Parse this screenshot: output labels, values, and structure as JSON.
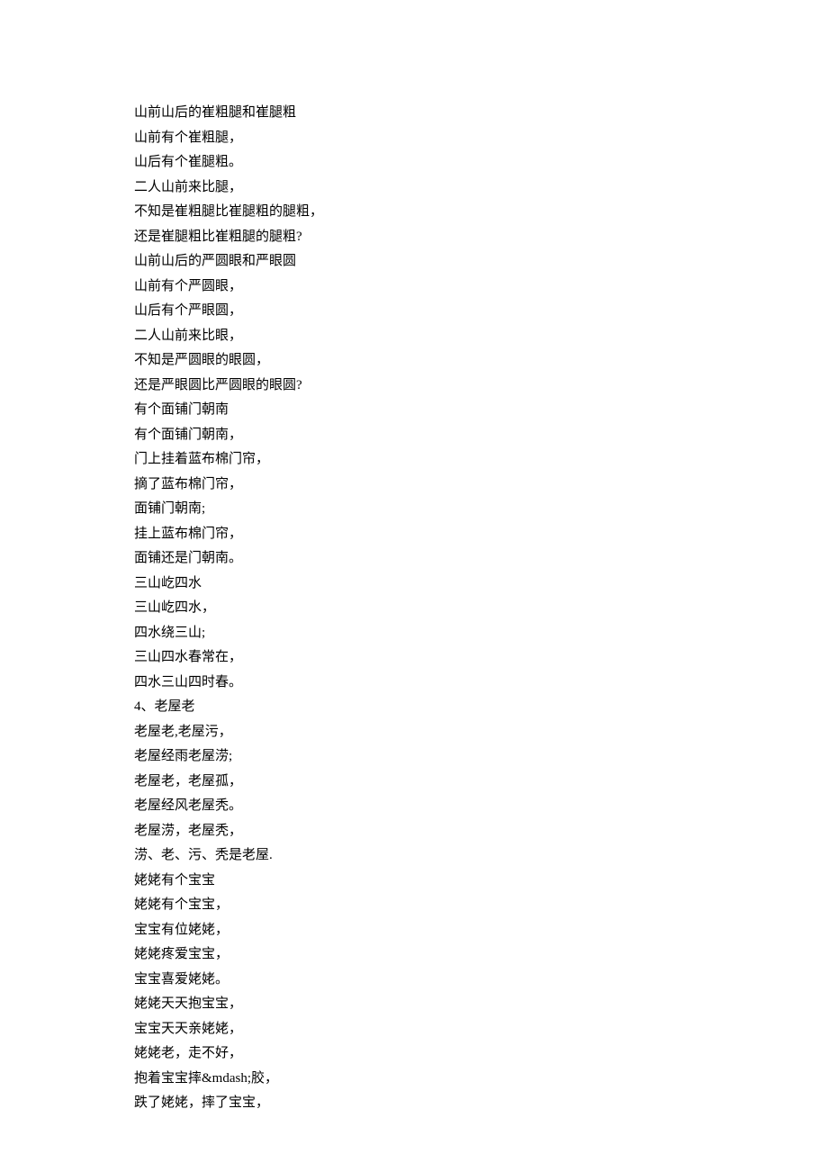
{
  "lines": [
    "山前山后的崔粗腿和崔腿粗",
    "山前有个崔粗腿，",
    "山后有个崔腿粗。",
    "二人山前来比腿，",
    "不知是崔粗腿比崔腿粗的腿粗，",
    "还是崔腿粗比崔粗腿的腿粗?",
    "山前山后的严圆眼和严眼圆",
    "山前有个严圆眼，",
    "山后有个严眼圆，",
    "二人山前来比眼，",
    "不知是严圆眼的眼圆，",
    "还是严眼圆比严圆眼的眼圆?",
    "有个面铺门朝南",
    "有个面铺门朝南，",
    "门上挂着蓝布棉门帘，",
    "摘了蓝布棉门帘，",
    "面铺门朝南;",
    "挂上蓝布棉门帘，",
    "面铺还是门朝南。",
    "三山屹四水",
    "三山屹四水，",
    "四水绕三山;",
    "三山四水春常在，",
    "四水三山四时春。",
    "4、老屋老",
    "老屋老,老屋污，",
    "老屋经雨老屋涝;",
    "老屋老，老屋孤，",
    "老屋经风老屋秃。",
    "老屋涝，老屋秃，",
    "涝、老、污、秃是老屋.",
    "姥姥有个宝宝",
    "姥姥有个宝宝，",
    "宝宝有位姥姥，",
    "姥姥疼爱宝宝，",
    "宝宝喜爱姥姥。",
    "姥姥天天抱宝宝，",
    "宝宝天天亲姥姥，",
    "姥姥老，走不好，",
    "抱着宝宝摔&mdash;胶，",
    "跌了姥姥，摔了宝宝，"
  ]
}
